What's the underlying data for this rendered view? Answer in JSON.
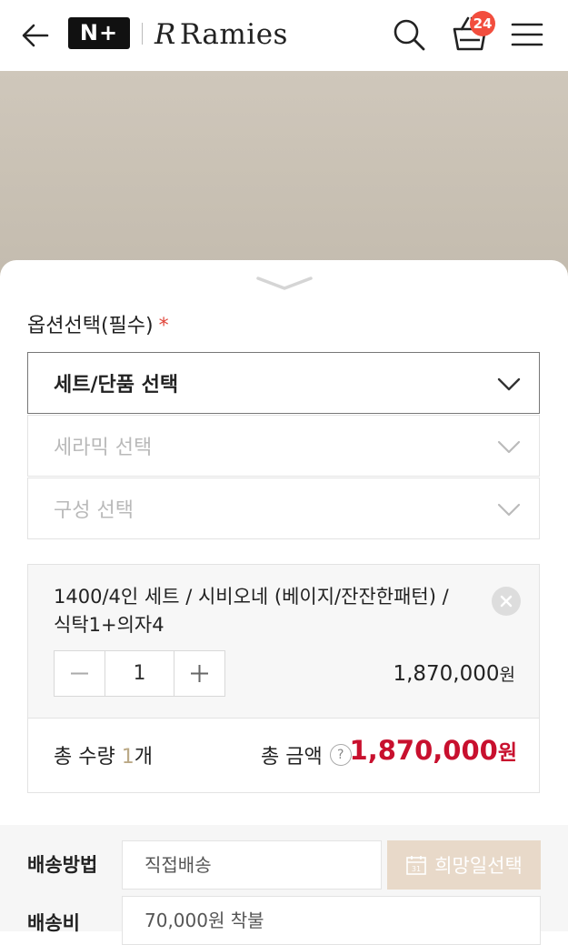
{
  "header": {
    "logo_text": "N+",
    "brand": "Ramies",
    "brand_mark": "R",
    "cart_count": "24",
    "icons": [
      "back-arrow-icon",
      "search-icon",
      "cart-icon",
      "menu-icon"
    ]
  },
  "options": {
    "title": "옵션선택(필수)",
    "required_mark": "*",
    "selects": [
      {
        "label": "세트/단품 선택",
        "state": "active"
      },
      {
        "label": "세라믹 선택",
        "state": "disabled"
      },
      {
        "label": "구성 선택",
        "state": "disabled"
      }
    ]
  },
  "selected_item": {
    "name": "1400/4인 세트 / 시비오네 (베이지/잔잔한패턴) / 식탁1+의자4",
    "quantity": "1",
    "price": "1,870,000",
    "currency": "원"
  },
  "totals": {
    "qty_label": "총 수량",
    "qty_value": "1",
    "qty_unit": "개",
    "amount_label": "총 금액",
    "help": "?",
    "amount": "1,870,000",
    "currency": "원"
  },
  "shipping": {
    "method_label": "배송방법",
    "method_value": "직접배송",
    "date_button": "희망일선택",
    "date_icon_number": "31",
    "fee_label": "배송비",
    "fee_value": "70,000원 착불"
  },
  "colors": {
    "accent_price": "#c8102e",
    "badge": "#f24e3e",
    "date_button_bg": "#e8d9c9"
  }
}
